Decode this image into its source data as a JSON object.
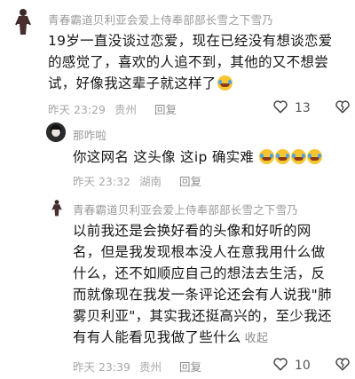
{
  "comments": [
    {
      "username": "青春霸道贝利亚会爱上侍奉部部长雪之下雪乃",
      "text": "19岁一直没谈过恋爱，现在已经没有想谈恋爱的感觉了，喜欢的人追不到，其他的又不想尝试，好像我这辈子就这样了",
      "emoji": "laugh-cry",
      "time": "昨天 23:29",
      "location": "贵州",
      "reply_label": "回复",
      "like_count": "13"
    },
    {
      "username": "那咋啦",
      "text": "你这网名 这头像 这ip 确实难",
      "emoji": "laugh-cry x4",
      "time": "昨天 23:32",
      "location": "湖南",
      "reply_label": "回复"
    },
    {
      "username": "青春霸道贝利亚会爱上侍奉部部长雪之下雪乃",
      "text": "以前我还是会换好看的头像和好听的网名，但是我发现根本没人在意我用什么做什么，还不如顺应自己的想法去生活，反而就像现在我发一条评论还会有人说我\"肺雾贝利亚\"，其实我还挺高兴的，至少我还有有人能看见我做了些什么",
      "collapse_label": "收起",
      "time": "昨天 23:39",
      "location": "贵州",
      "reply_label": "回复",
      "like_count": "10"
    }
  ]
}
